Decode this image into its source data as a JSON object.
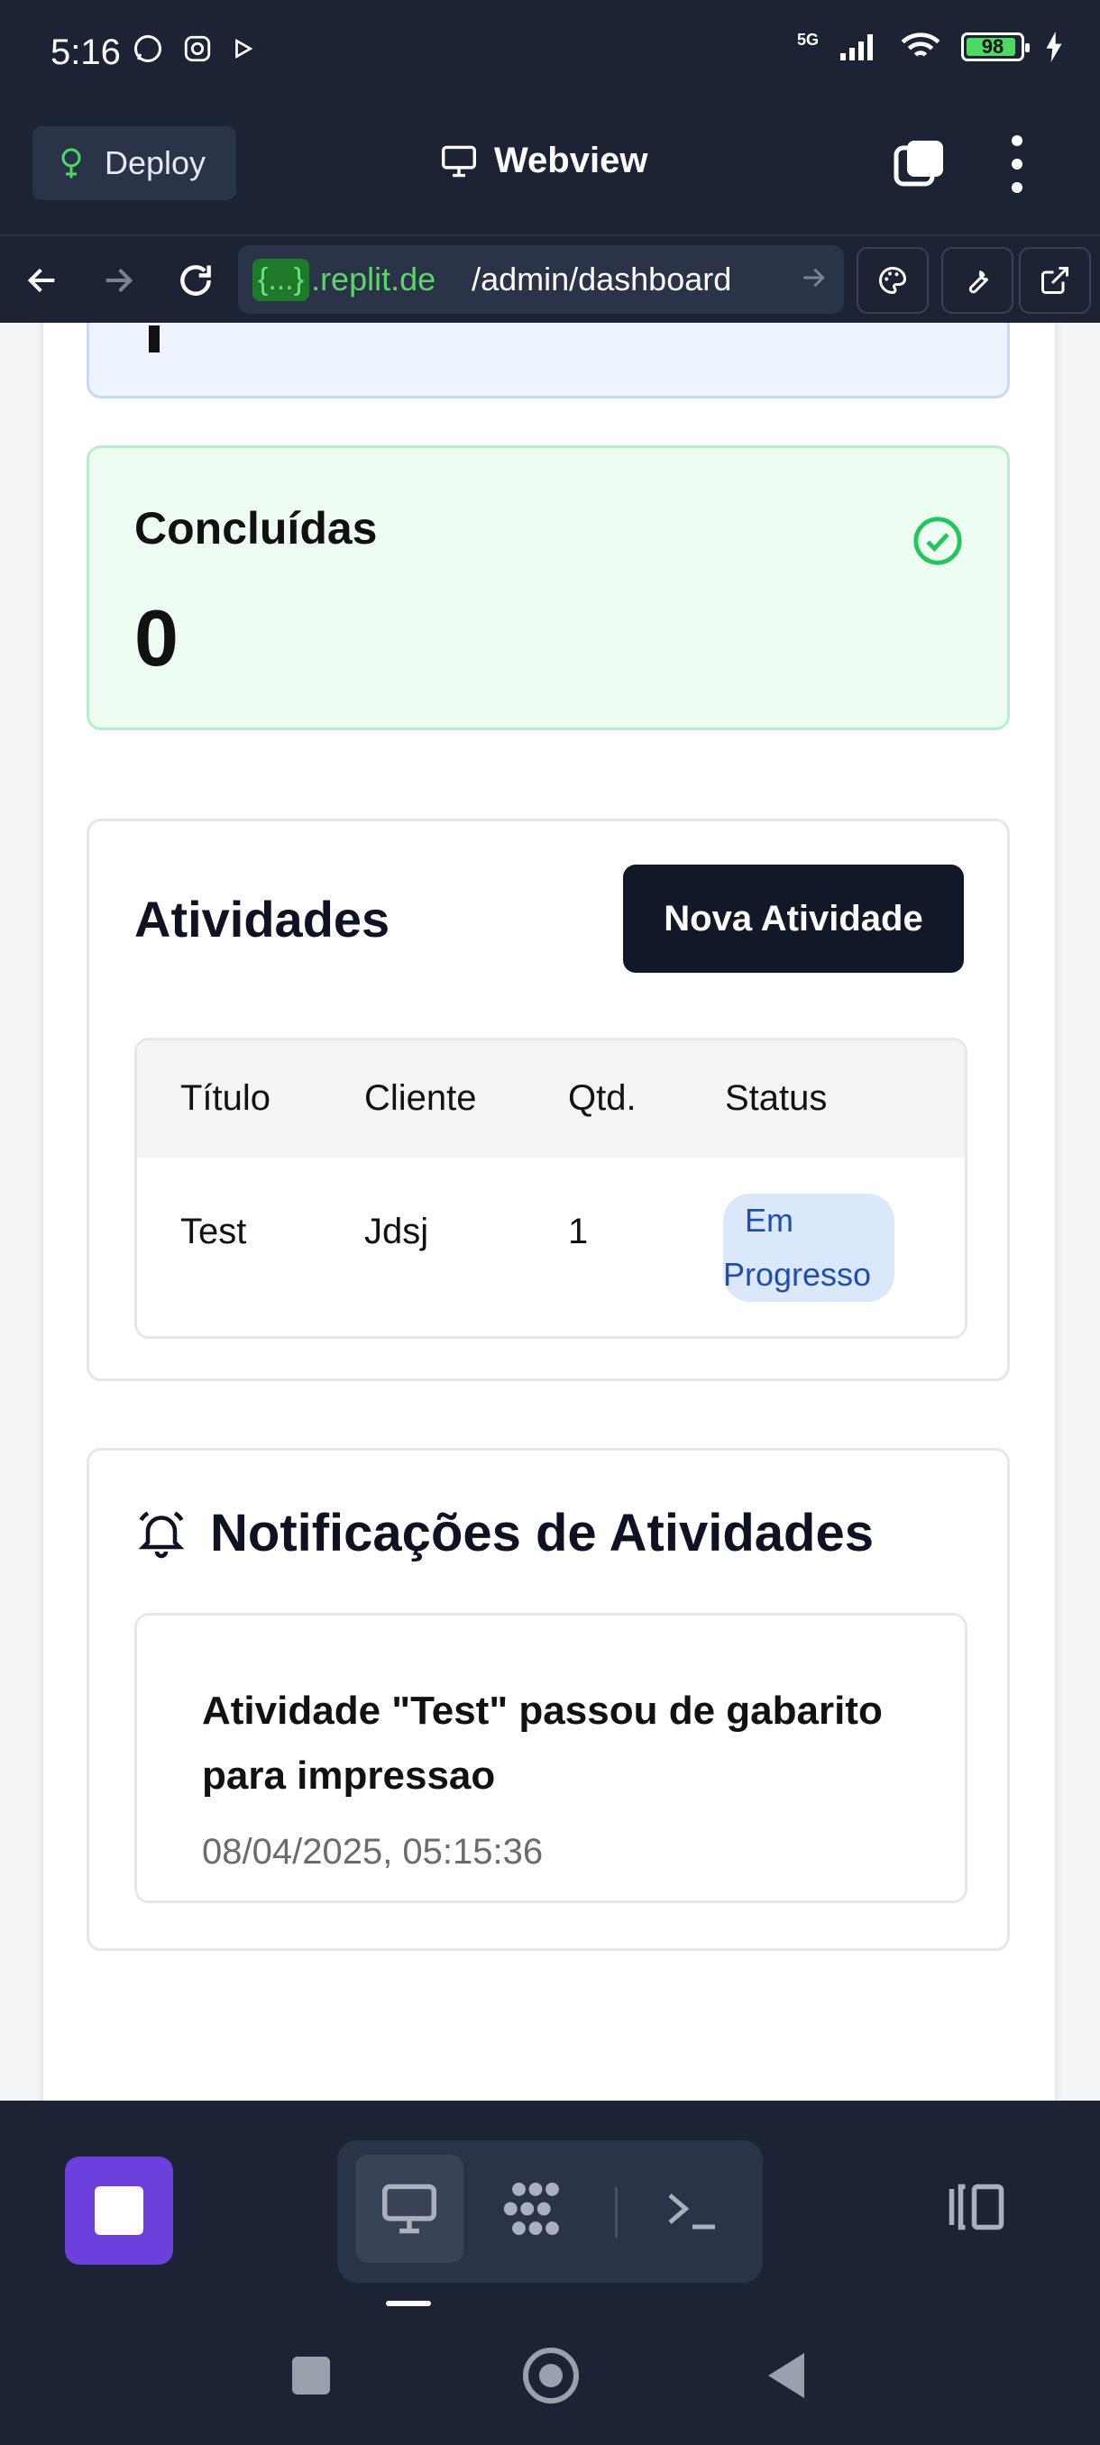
{
  "status_bar": {
    "time": "5:16",
    "network": "5G",
    "battery": "98"
  },
  "app_bar": {
    "deploy_label": "Deploy",
    "title": "Webview"
  },
  "browser": {
    "url_prefix": "{...}",
    "url_host": ".replit.de",
    "url_path": "/admin/dashboard"
  },
  "stats": {
    "completed_label": "Concluídas",
    "completed_value": "0"
  },
  "activities": {
    "title": "Atividades",
    "new_button": "Nova Atividade",
    "columns": [
      "Título",
      "Cliente",
      "Qtd.",
      "Status"
    ],
    "rows": [
      {
        "title": "Test",
        "client": "Jdsj",
        "qty": "1",
        "status_line1": "Em",
        "status_line2": "Progresso"
      }
    ]
  },
  "notifications": {
    "title": "Notificações de Atividades",
    "items": [
      {
        "text": "Atividade \"Test\" passou de gabarito para impressao",
        "time": "08/04/2025, 05:15:36"
      }
    ]
  },
  "colors": {
    "accent_purple": "#6d3fdc",
    "success_green": "#22c55e",
    "badge_blue": "#1f4fa8"
  }
}
